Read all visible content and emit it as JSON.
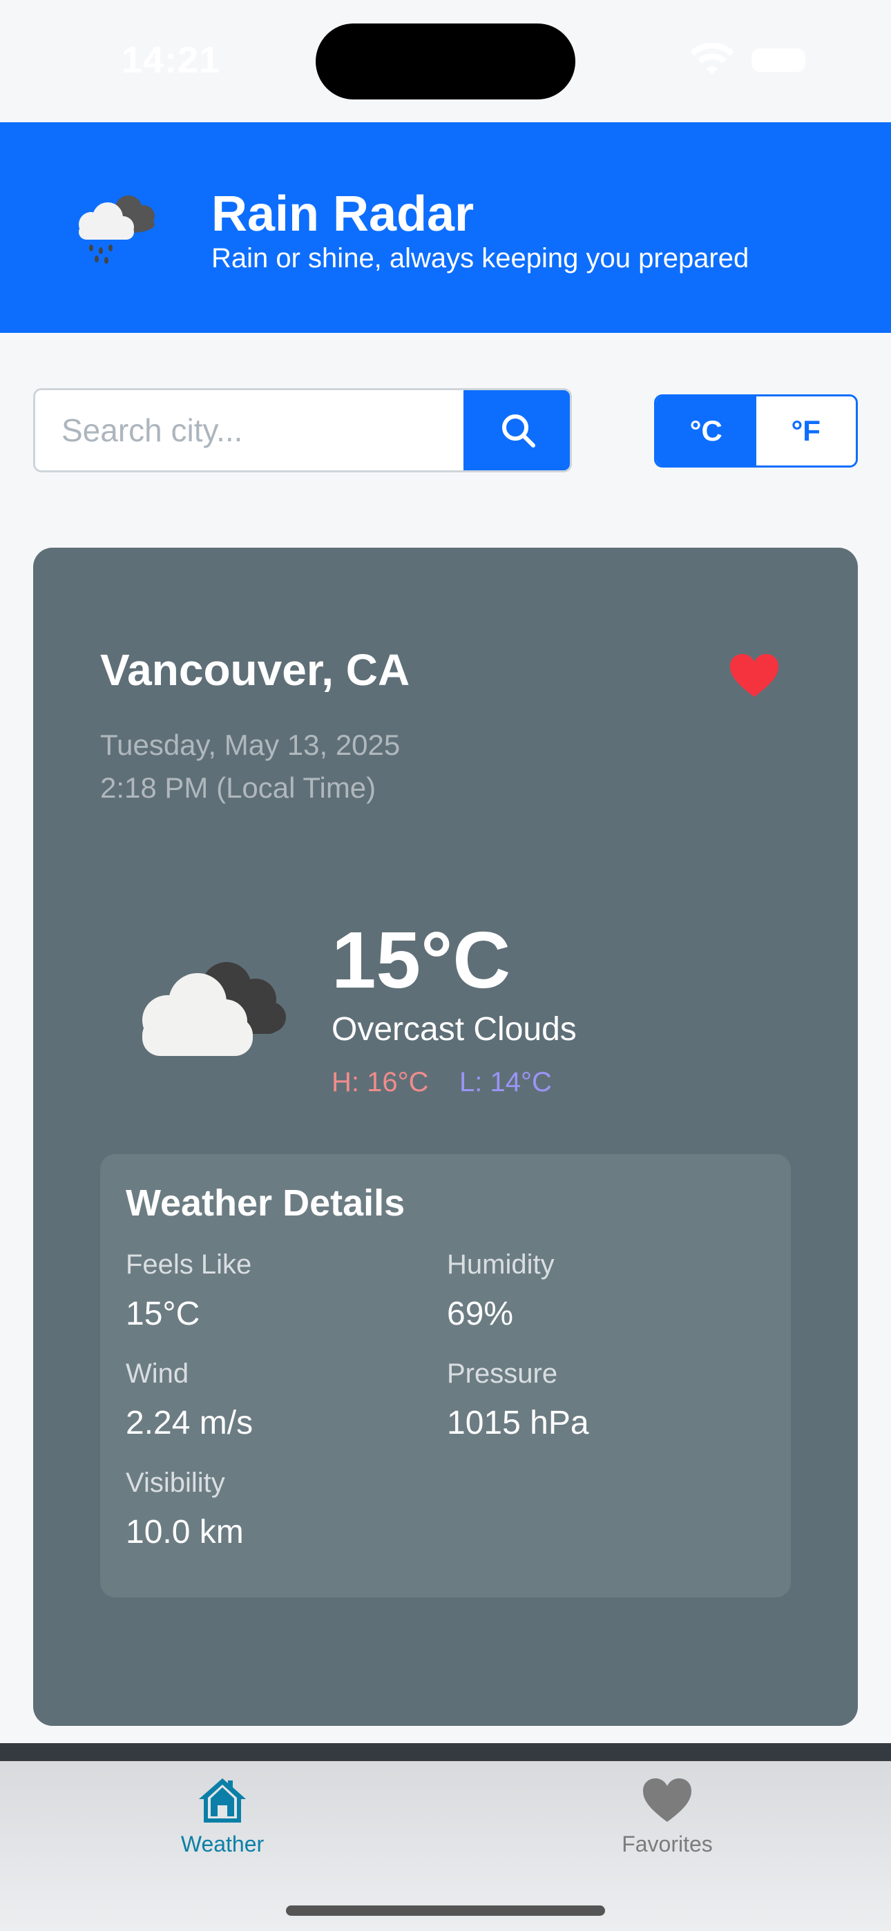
{
  "status_bar": {
    "time": "14:21"
  },
  "header": {
    "logo_icon": "rain-cloud-icon",
    "title": "Rain Radar",
    "subtitle": "Rain or shine, always keeping you prepared"
  },
  "search": {
    "placeholder": "Search city...",
    "value": "",
    "button_icon": "search-icon"
  },
  "units": {
    "celsius_label": "°C",
    "fahrenheit_label": "°F",
    "selected": "°C"
  },
  "weather": {
    "city": "Vancouver, CA",
    "favorite_icon": "heart-icon",
    "date": "Tuesday, May 13, 2025",
    "local_time": "2:18 PM (Local Time)",
    "condition_icon": "overcast-cloud-icon",
    "temperature": "15°C",
    "description": "Overcast Clouds",
    "high": "H: 16°C",
    "low": "L: 14°C"
  },
  "details": {
    "title": "Weather Details",
    "items": [
      {
        "label": "Feels Like",
        "value": "15°C"
      },
      {
        "label": "Humidity",
        "value": "69%"
      },
      {
        "label": "Wind",
        "value": "2.24 m/s"
      },
      {
        "label": "Pressure",
        "value": "1015 hPa"
      },
      {
        "label": "Visibility",
        "value": "10.0 km"
      }
    ]
  },
  "tab_bar": {
    "tabs": [
      {
        "label": "Weather",
        "icon": "home-icon",
        "active": true
      },
      {
        "label": "Favorites",
        "icon": "heart-icon",
        "active": false
      }
    ]
  },
  "colors": {
    "brand_blue": "#0d6efd",
    "card": "#5f6f77",
    "details_panel": "#6c7c83",
    "favorite_red": "#f5333f",
    "high_temp": "#f08c8c",
    "low_temp": "#9a95f5",
    "active_tab": "#0b7fa7"
  }
}
